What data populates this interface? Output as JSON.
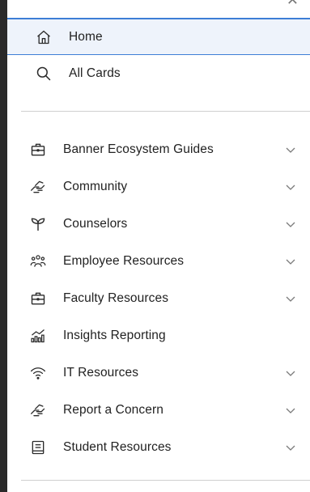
{
  "nav_top": {
    "home_label": "Home",
    "all_cards_label": "All Cards"
  },
  "menu": {
    "items": [
      {
        "label": "Banner Ecosystem Guides",
        "icon": "briefcase-icon",
        "has_chevron": true
      },
      {
        "label": "Community",
        "icon": "handshake-icon",
        "has_chevron": true
      },
      {
        "label": "Counselors",
        "icon": "sprout-icon",
        "has_chevron": true
      },
      {
        "label": "Employee Resources",
        "icon": "people-icon",
        "has_chevron": true
      },
      {
        "label": "Faculty Resources",
        "icon": "briefcase-icon",
        "has_chevron": true
      },
      {
        "label": "Insights Reporting",
        "icon": "analytics-icon",
        "has_chevron": false
      },
      {
        "label": "IT Resources",
        "icon": "wifi-icon",
        "has_chevron": true
      },
      {
        "label": "Report a Concern",
        "icon": "handshake-icon",
        "has_chevron": true
      },
      {
        "label": "Student Resources",
        "icon": "document-icon",
        "has_chevron": true
      }
    ]
  },
  "colors": {
    "active_border": "#3d7ed6",
    "active_bg": "#eef3fb",
    "frame": "#2a2a2a"
  }
}
